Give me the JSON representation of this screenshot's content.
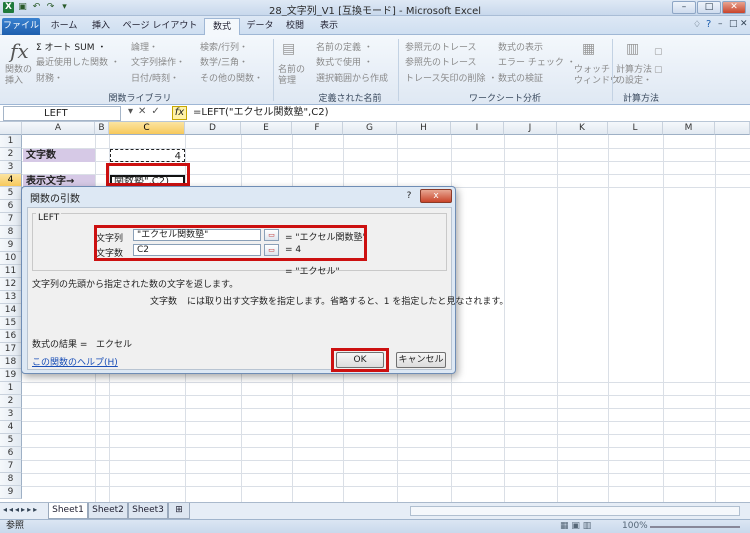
{
  "titlebar": {
    "title": "28_文字列_V1  [互換モード] - Microsoft Excel"
  },
  "tabs": [
    "ファイル",
    "ホーム",
    "挿入",
    "ページ レイアウト",
    "数式",
    "データ",
    "校閲",
    "表示"
  ],
  "ribbon": {
    "insert_function": "関数の\n挿入",
    "lib_items": [
      "Σ オート SUM ・",
      "最近使用した関数 ・",
      "財務・",
      "論理・",
      "文字列操作・",
      "日付/時刻・",
      "検索/行列・",
      "数学/三角・",
      "その他の関数・"
    ],
    "group_lib": "関数ライブラリ",
    "name_mgr": "名前の\n管理",
    "name_items": [
      "名前の定義 ・",
      "数式で使用 ・",
      "選択範囲から作成"
    ],
    "group_names": "定義された名前",
    "audit_items": [
      "参照元のトレース",
      "参照先のトレース",
      "トレース矢印の削除 ・",
      "数式の表示",
      "エラー チェック ・",
      "数式の検証"
    ],
    "watch": "ウォッチ\nウィンドウ",
    "group_audit": "ワークシート分析",
    "calc_opt": "計算方法\nの設定・",
    "group_calc": "計算方法"
  },
  "formula_bar": {
    "name_box": "LEFT",
    "fx": "fx",
    "formula": "=LEFT(\"エクセル関数塾\",C2)"
  },
  "columns": [
    "A",
    "B",
    "C",
    "D",
    "E",
    "F",
    "G",
    "H",
    "I",
    "J",
    "K",
    "L",
    "M"
  ],
  "rows": [
    "1",
    "2",
    "3",
    "4",
    "5",
    "6",
    "7",
    "8",
    "9",
    "10",
    "11",
    "12",
    "13",
    "14",
    "15",
    "16",
    "17",
    "18",
    "19",
    "1",
    "2",
    "3",
    "4",
    "5",
    "6",
    "7",
    "8",
    "9",
    "0"
  ],
  "cells": {
    "a2": "文字数",
    "c2": "4",
    "a4": "表示文字→",
    "c4": "関数塾\",C2)"
  },
  "dialog": {
    "title": "関数の引数",
    "help_q": "?",
    "close": "x",
    "function_name": "LEFT",
    "arg1_label": "文字列",
    "arg1_value": "\"エクセル関数塾\"",
    "arg1_result": "= \"エクセル関数塾\"",
    "arg2_label": "文字数",
    "arg2_value": "C2",
    "arg2_result": "= 4",
    "overall_result": "= \"エクセル\"",
    "description": "文字列の先頭から指定された数の文字を返します。",
    "arg_desc_name": "文字数",
    "arg_desc": "には取り出す文字数を指定します。省略すると、1 を指定したと見なされます。",
    "result_label": "数式の結果 =",
    "result_value": "エクセル",
    "help_link": "この関数のヘルプ(H)",
    "ok": "OK",
    "cancel": "キャンセル"
  },
  "sheets": [
    "Sheet1",
    "Sheet2",
    "Sheet3"
  ],
  "status": {
    "mode": "参照",
    "zoom": "100%"
  },
  "colors": {
    "highlight_red": "#cc1010",
    "label_fill": "#d6c9e6",
    "selected_header": "#f7c95b"
  }
}
